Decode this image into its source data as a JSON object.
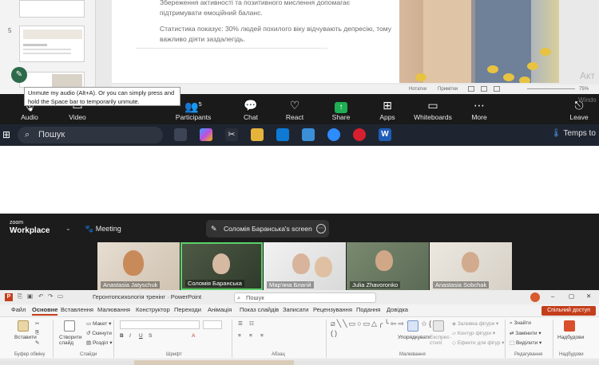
{
  "ppt_top": {
    "thumb_num": "5",
    "slide_text_1": "Збереження активності та позитивного мислення допомагає підтримувати емоційний баланс.",
    "slide_text_2": "Статистика показує: 30% людей похилого віку відчувають депресію, тому важливо діяти заздалегідь.",
    "status_notes": "Нотатки",
    "status_comments": "Примітки",
    "zoom_level": "75%",
    "watermark": "Акт"
  },
  "tooltip": "Unmute my audio (Alt+A). Or you can simply press and hold the Space bar to temporarily unmute.",
  "zoom_toolbar": {
    "audio": "Audio",
    "video": "Video",
    "participants": "Participants",
    "participants_count": "5",
    "chat": "Chat",
    "react": "React",
    "share": "Share",
    "apps": "Apps",
    "whiteboards": "Whiteboards",
    "more": "More",
    "leave": "Leave",
    "windows_wm": "Windo"
  },
  "taskbar": {
    "search_placeholder": "Пошук",
    "weather": "Temps to"
  },
  "zoom_top": {
    "logo_line1": "zoom",
    "logo_line2": "Workplace",
    "meeting": "Meeting",
    "screen_share": "Соломія Баранська's screen",
    "participants": [
      "Anastasia Jatyschuk",
      "Соломія Баранська",
      "Мар'яна Благій",
      "Julia Zhavoronko",
      "Anastasia Sobchak"
    ]
  },
  "powerpoint": {
    "doc_title": "Геронтопсихологія тренінг  ·  PowerPoint",
    "search": "Пошук",
    "share_button": "Спільний доступ",
    "tabs": [
      "Файл",
      "Основне",
      "Вставлення",
      "Малювання",
      "Конструктор",
      "Переходи",
      "Анімація",
      "Показ слайдів",
      "Записати",
      "Рецензування",
      "Подання",
      "Довідка"
    ],
    "ribbon": {
      "paste": "Вставити",
      "clipboard": "Буфер обміну",
      "new_slide": "Створити слайд",
      "layout": "Макет",
      "reset": "Скинути",
      "section": "Розділ",
      "slides": "Слайди",
      "font": "Шрифт",
      "paragraph": "Абзац",
      "arrange": "Упорядкувати",
      "quick_styles": "Експрес-стилі",
      "shape_fill": "Заливка фігури",
      "shape_outline": "Контур фігури",
      "shape_effects": "Ефекти для фігур",
      "drawing": "Малювання",
      "find": "Знайти",
      "replace": "Замінити",
      "select": "Виділити",
      "editing": "Редагування",
      "addins": "Надбудови",
      "addins_group": "Надбудови"
    }
  }
}
